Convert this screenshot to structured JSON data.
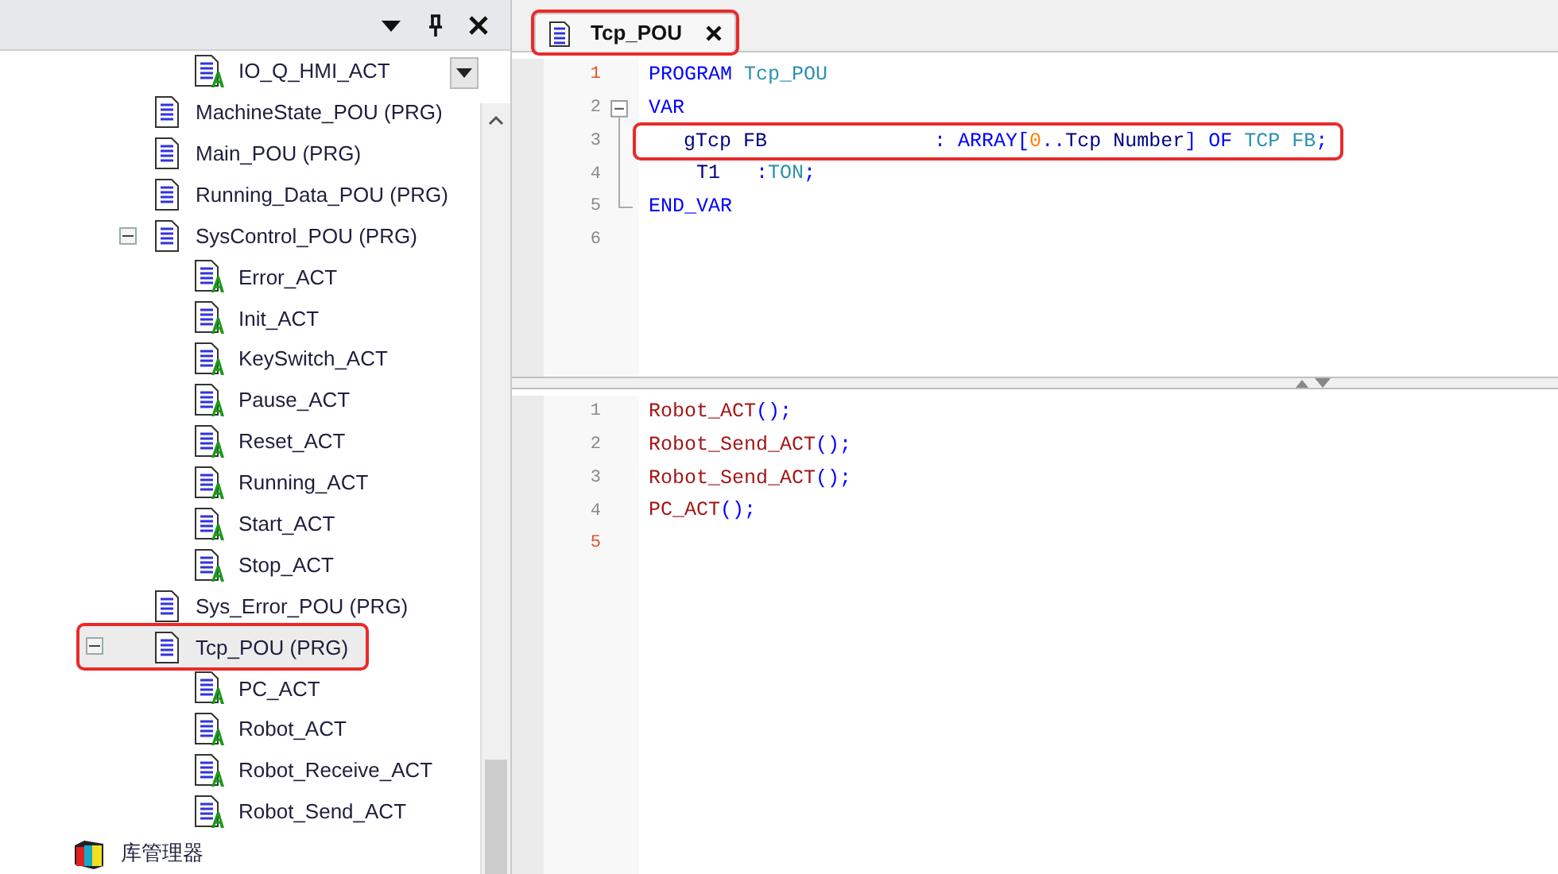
{
  "tree_panel": {
    "header_buttons": [
      {
        "kind": "dropdown"
      },
      {
        "kind": "pin"
      },
      {
        "kind": "close"
      }
    ],
    "items": [
      {
        "children": [
          {
            "label": "IO_Q_HMI_ACT",
            "kind": "action",
            "selected": false
          }
        ]
      },
      {
        "label": "MachineState_POU (PRG)",
        "kind": "program",
        "selected": false
      },
      {
        "label": "Main_POU (PRG)",
        "kind": "program",
        "selected": false
      },
      {
        "label": "Running_Data_POU (PRG)",
        "kind": "program",
        "selected": false
      },
      {
        "label": "SysControl_POU (PRG)",
        "kind": "program",
        "selected": false,
        "expanded": true,
        "children": [
          {
            "label": "Error_ACT",
            "kind": "action",
            "selected": false
          },
          {
            "label": "Init_ACT",
            "kind": "action",
            "selected": false
          },
          {
            "label": "KeySwitch_ACT",
            "kind": "action",
            "selected": false
          },
          {
            "label": "Pause_ACT",
            "kind": "action",
            "selected": false
          },
          {
            "label": "Reset_ACT",
            "kind": "action",
            "selected": false
          },
          {
            "label": "Running_ACT",
            "kind": "action",
            "selected": false
          },
          {
            "label": "Start_ACT",
            "kind": "action",
            "selected": false
          },
          {
            "label": "Stop_ACT",
            "kind": "action",
            "selected": false
          }
        ]
      },
      {
        "label": "Sys_Error_POU (PRG)",
        "kind": "program",
        "selected": false
      },
      {
        "label": "Tcp_POU (PRG)",
        "kind": "program",
        "selected": true,
        "annotated": true,
        "expanded": true,
        "children": [
          {
            "label": "PC_ACT",
            "kind": "action",
            "selected": false
          },
          {
            "label": "Robot_ACT",
            "kind": "action",
            "selected": false
          },
          {
            "label": "Robot_Receive_ACT",
            "kind": "action",
            "selected": false
          },
          {
            "label": "Robot_Send_ACT",
            "kind": "action",
            "selected": false
          }
        ]
      }
    ],
    "library_item": {
      "label": "库管理器",
      "kind": "library"
    }
  },
  "editor": {
    "tabs": [
      {
        "label": "Tcp_POU",
        "selected": true,
        "annotated": true
      }
    ],
    "declaration_lines": [
      {
        "number": "1",
        "current": true,
        "tokens": [
          {
            "text": "PROGRAM ",
            "kind": "keyword"
          },
          {
            "text": "Tcp_POU",
            "kind": "type"
          }
        ]
      },
      {
        "number": "2",
        "current": false,
        "fold_start": true,
        "tokens": [
          {
            "text": "VAR",
            "kind": "keyword"
          }
        ]
      },
      {
        "number": "3",
        "current": false,
        "annotated": true,
        "tokens": [
          {
            "text": "    gTcp FB              ",
            "kind": "ident"
          },
          {
            "text": ": ARRAY[",
            "kind": "keyword"
          },
          {
            "text": "0",
            "kind": "number"
          },
          {
            "text": "..",
            "kind": "keyword"
          },
          {
            "text": "Tcp Number",
            "kind": "ident"
          },
          {
            "text": "] OF ",
            "kind": "keyword"
          },
          {
            "text": "TCP FB",
            "kind": "type"
          },
          {
            "text": ";",
            "kind": "keyword"
          }
        ]
      },
      {
        "number": "4",
        "current": false,
        "tokens": [
          {
            "text": "    T1   ",
            "kind": "ident"
          },
          {
            "text": ":",
            "kind": "keyword"
          },
          {
            "text": "TON",
            "kind": "type"
          },
          {
            "text": ";",
            "kind": "keyword"
          }
        ]
      },
      {
        "number": "5",
        "current": false,
        "fold_end": true,
        "tokens": [
          {
            "text": "END_VAR",
            "kind": "keyword"
          }
        ]
      },
      {
        "number": "6",
        "current": false
      }
    ],
    "body_lines": [
      {
        "number": "1",
        "current": false,
        "tokens": [
          {
            "text": "Robot_ACT",
            "kind": "call"
          },
          {
            "text": "();",
            "kind": "keyword"
          }
        ]
      },
      {
        "number": "2",
        "current": false,
        "tokens": [
          {
            "text": "Robot_Send_ACT",
            "kind": "call"
          },
          {
            "text": "();",
            "kind": "keyword"
          }
        ]
      },
      {
        "number": "3",
        "current": false,
        "tokens": [
          {
            "text": "Robot_Send_ACT",
            "kind": "call"
          },
          {
            "text": "();",
            "kind": "keyword"
          }
        ]
      },
      {
        "number": "4",
        "current": false,
        "tokens": [
          {
            "text": "PC_ACT",
            "kind": "call"
          },
          {
            "text": "();",
            "kind": "keyword"
          }
        ]
      },
      {
        "number": "5",
        "current": true
      }
    ]
  }
}
